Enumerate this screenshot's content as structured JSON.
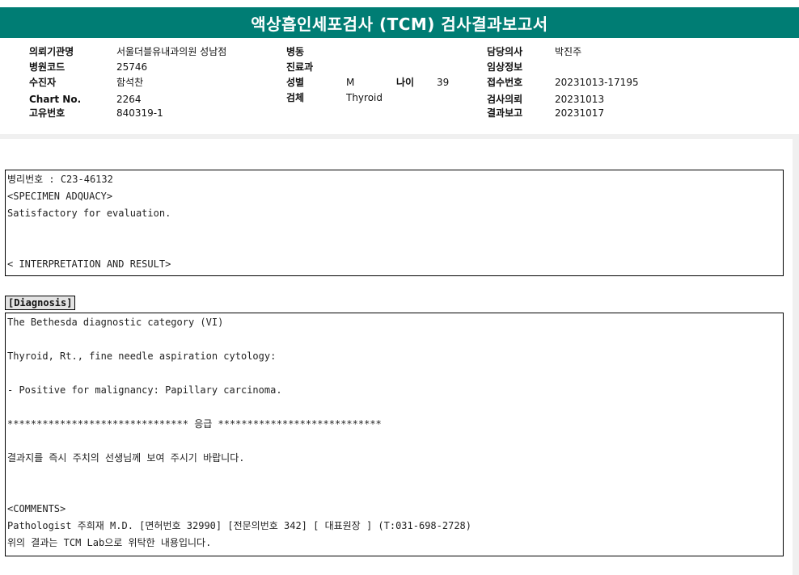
{
  "report": {
    "title": "액상흡인세포검사 (TCM) 검사결과보고서"
  },
  "header": {
    "col1": [
      {
        "label": "의뢰기관명",
        "value": "서울더블유내과의원 성남점"
      },
      {
        "label": "병원코드",
        "value": "25746"
      },
      {
        "label": "수진자",
        "value": "함석찬"
      },
      {
        "label": "Chart No.",
        "value": "2264"
      },
      {
        "label": "고유번호",
        "value": "840319-1"
      }
    ],
    "col2": [
      {
        "label": "병동",
        "value": ""
      },
      {
        "label": "진료과",
        "value": ""
      },
      {
        "label": "성별",
        "value": "M"
      },
      {
        "label": "검체",
        "value": "Thyroid"
      }
    ],
    "age": {
      "label": "나이",
      "value": "39"
    },
    "col3": [
      {
        "label": "담당의사",
        "value": "박진주"
      },
      {
        "label": "임상정보",
        "value": ""
      },
      {
        "label": "접수번호",
        "value": "20231013-17195"
      },
      {
        "label": "검사의뢰",
        "value": "20231013"
      },
      {
        "label": "결과보고",
        "value": "20231017"
      }
    ]
  },
  "specimen_box": {
    "lines": [
      "병리번호 : C23-46132",
      "<SPECIMEN ADQUACY>",
      "Satisfactory for evaluation.",
      "",
      "",
      "< INTERPRETATION AND RESULT>"
    ]
  },
  "diagnosis": {
    "label": "[Diagnosis]",
    "lines": [
      "The Bethesda diagnostic category (VI)",
      "",
      "Thyroid, Rt., fine needle aspiration cytology:",
      "",
      "- Positive for malignancy: Papillary carcinoma.",
      "",
      "******************************* 응급 ****************************",
      "",
      "결과지를 즉시 주치의 선생님께 보여 주시기 바랍니다.",
      "",
      "",
      "<COMMENTS>",
      "Pathologist 주희재 M.D. [면허번호 32990] [전문의번호 342] [ 대표원장 ] (T:031-698-2728)",
      "위의 결과는 TCM Lab으로 위탁한 내용입니다."
    ]
  }
}
